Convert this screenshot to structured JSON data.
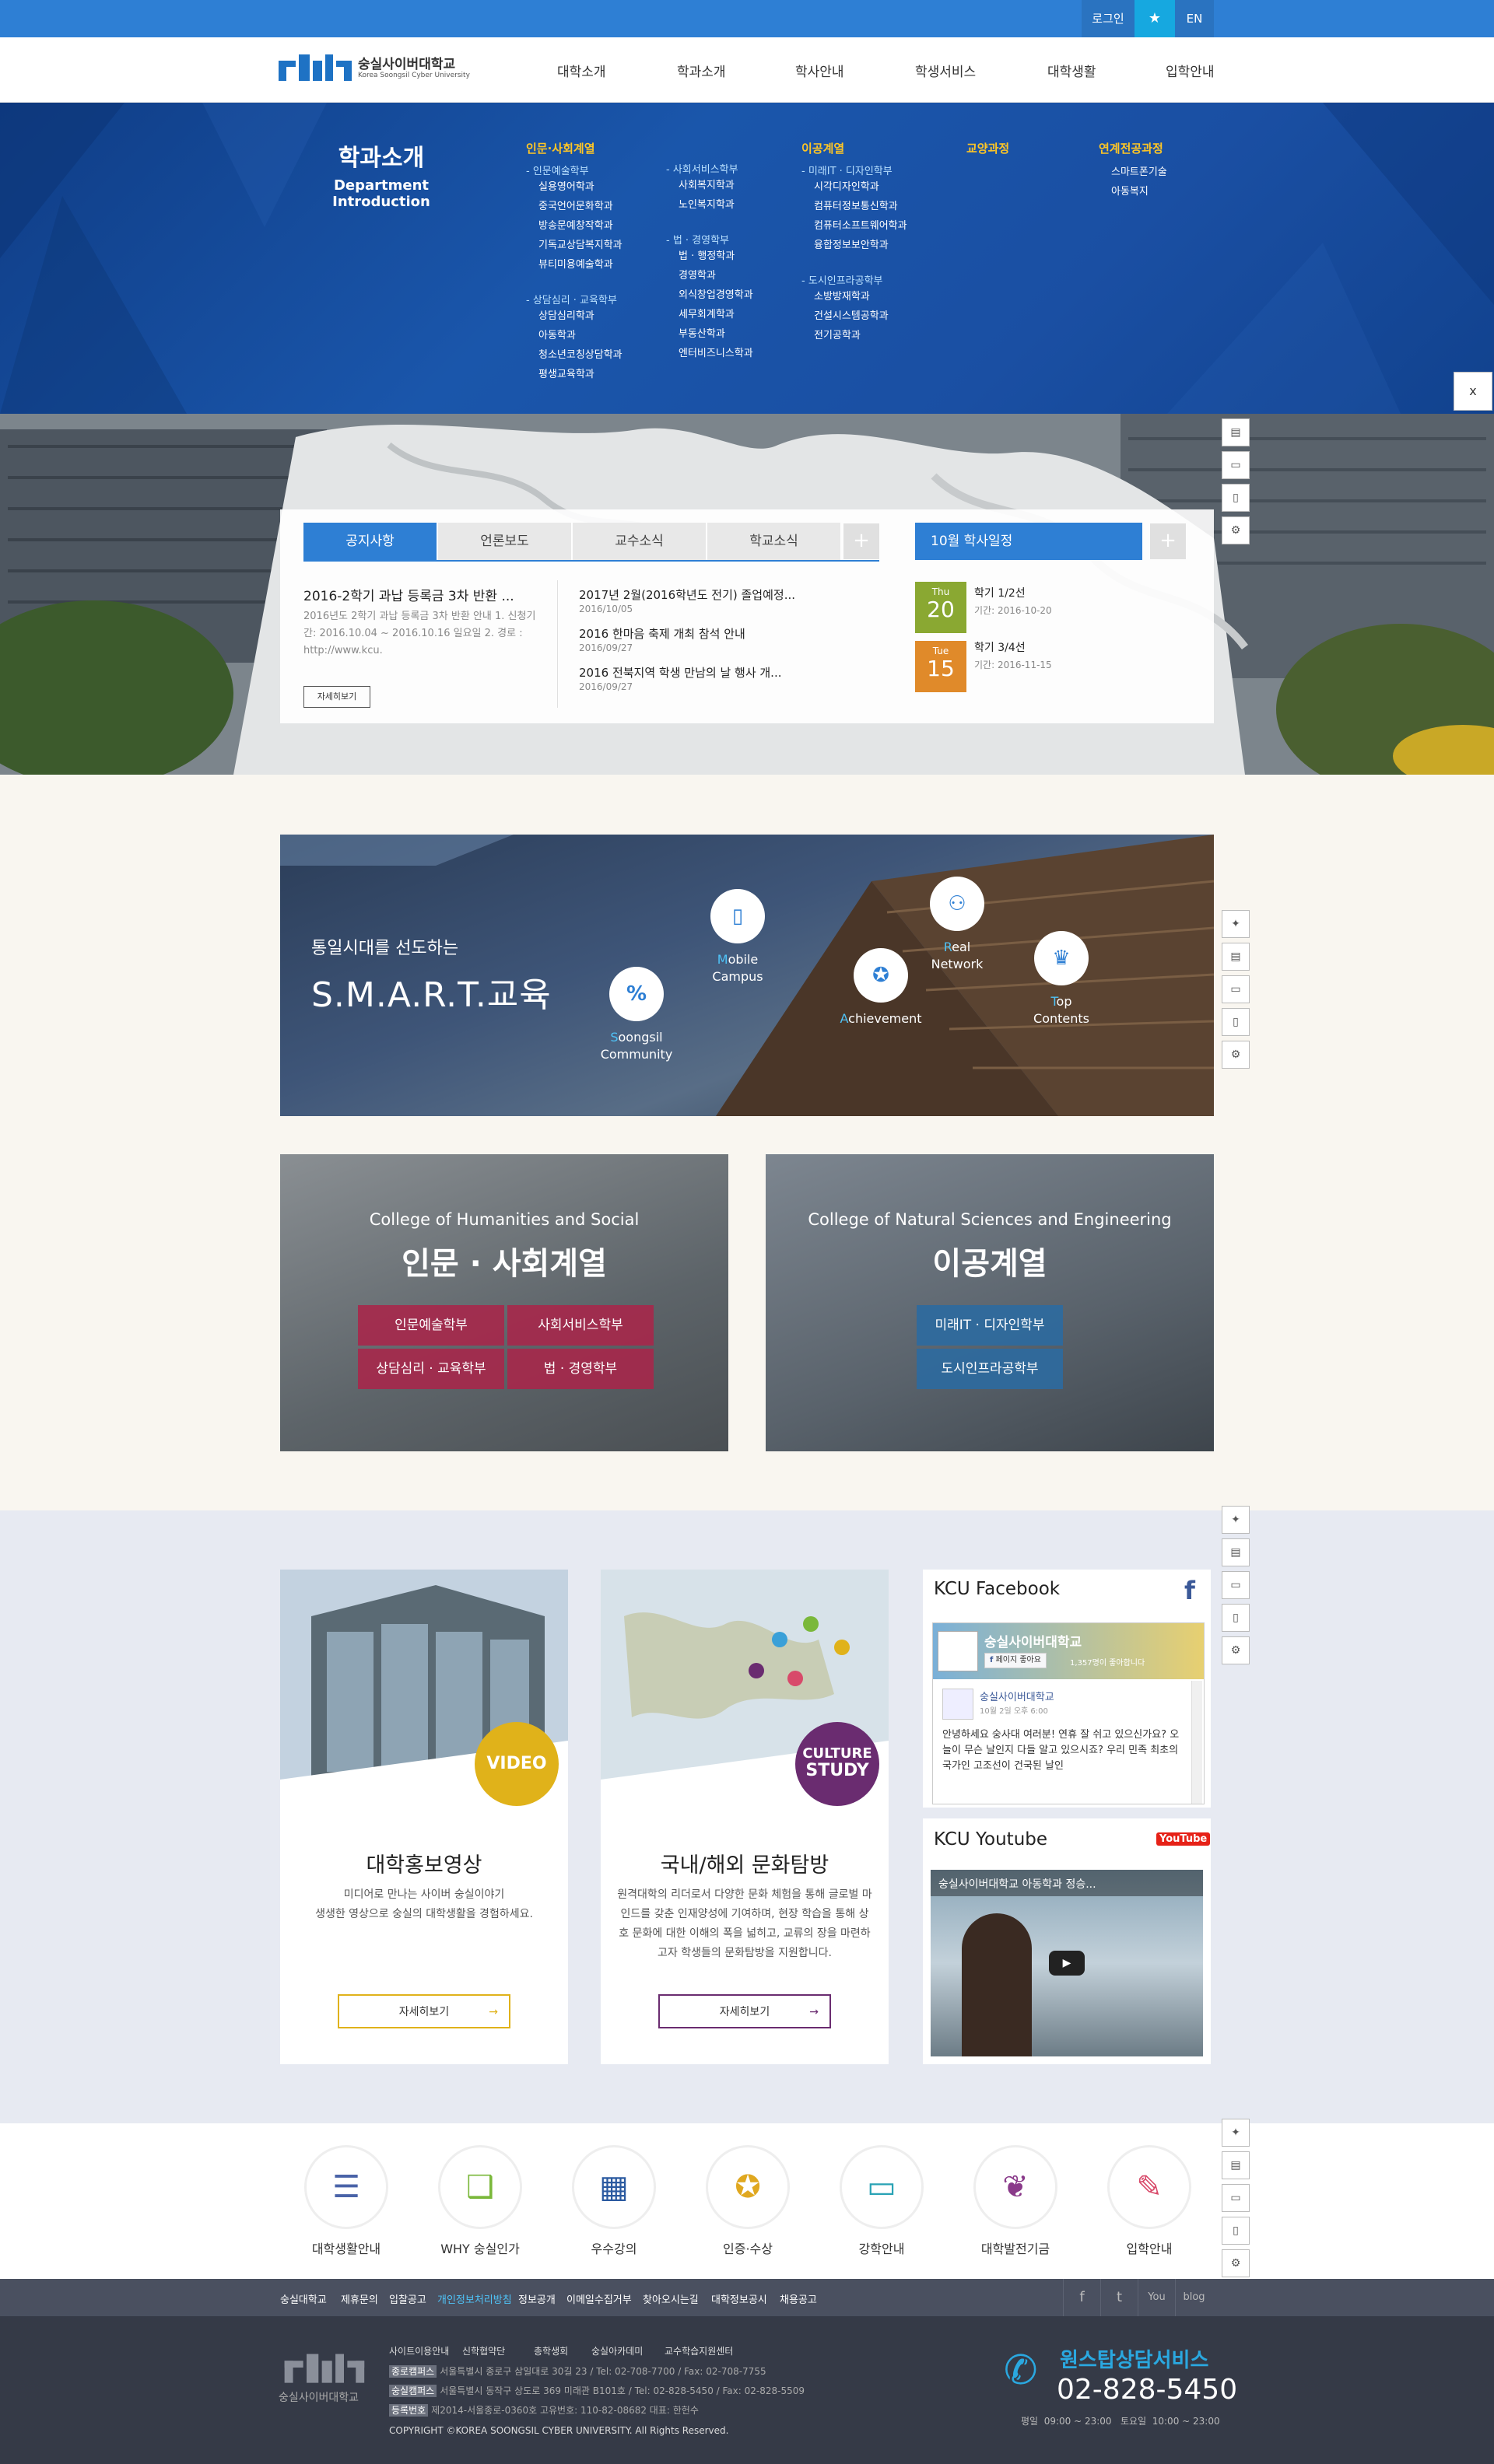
{
  "util": {
    "login": "로그인",
    "lang": "EN"
  },
  "logo": {
    "name": "숭실사이버대학교",
    "sub": "Korea Soongsil Cyber University",
    "mark": "kcu"
  },
  "gnb": [
    "대학소개",
    "학과소개",
    "학사안내",
    "학생서비스",
    "대학생활",
    "입학안내"
  ],
  "mega": {
    "title": "학과소개",
    "title_en": "Department Introduction",
    "columns": [
      {
        "head": "인문·사회계열",
        "groups": [
          {
            "name": "- 인문예술학부",
            "items": [
              "실용영어학과",
              "중국언어문화학과",
              "방송문예창작학과",
              "기독교상담복지학과",
              "뷰티미용예술학과"
            ]
          },
          {
            "name": "- 상담심리 · 교육학부",
            "items": [
              "상담심리학과",
              "아동학과",
              "청소년코칭상담학과",
              "평생교육학과"
            ]
          }
        ]
      },
      {
        "head": "",
        "groups": [
          {
            "name": "- 사회서비스학부",
            "items": [
              "사회복지학과",
              "노인복지학과"
            ]
          },
          {
            "name": "- 법 · 경영학부",
            "items": [
              "법 · 행정학과",
              "경영학과",
              "외식창업경영학과",
              "세무회계학과",
              "부동산학과",
              "엔터비즈니스학과"
            ]
          }
        ]
      },
      {
        "head": "이공계열",
        "groups": [
          {
            "name": "- 미래IT · 디자인학부",
            "items": [
              "시각디자인학과",
              "컴퓨터정보통신학과",
              "컴퓨터소프트웨어학과",
              "융합정보보안학과"
            ]
          },
          {
            "name": "- 도시인프라공학부",
            "items": [
              "소방방재학과",
              "건설시스템공학과",
              "전기공학과"
            ]
          }
        ]
      },
      {
        "head": "교양과정",
        "groups": []
      },
      {
        "head": "연계전공과정",
        "groups": [
          {
            "name": "",
            "items": [
              "스마트폰기술",
              "아동복지"
            ]
          }
        ]
      }
    ],
    "close": "x"
  },
  "notice": {
    "tabs": [
      "공지사항",
      "언론보도",
      "교수소식",
      "학교소식"
    ],
    "plus": "+",
    "featured": {
      "title": "2016-2학기 과납 등록금 3차 반환 ...",
      "body": "2016년도 2학기 과납 등록금 3차 반환 안내 1. 신청기간: 2016.10.04 ~ 2016.10.16 일요일 2. 경로 : http://www.kcu.",
      "more": "자세히보기"
    },
    "items": [
      {
        "title": "2017년 2월(2016학년도 전기) 졸업예정...",
        "date": "2016/10/05"
      },
      {
        "title": "2016 한마음 축제 개최 참석 안내",
        "date": "2016/09/27"
      },
      {
        "title": "2016 전북지역 학생 만남의 날 행사 개...",
        "date": "2016/09/27"
      }
    ]
  },
  "schedule": {
    "title": "10월 학사일정",
    "plus": "+",
    "events": [
      {
        "dow": "Thu",
        "day": "20",
        "title": "학기 1/2선",
        "period": "기간: 2016-10-20",
        "color": "#8aa832"
      },
      {
        "dow": "Tue",
        "day": "15",
        "title": "학기 3/4선",
        "period": "기간: 2016-11-15",
        "color": "#e08a2a"
      }
    ]
  },
  "smart": {
    "sub": "통일시대를 선도하는",
    "title": "S.M.A.R.T.교육",
    "items": [
      {
        "first": "S",
        "rest": "oongsil",
        "line2": "Community"
      },
      {
        "first": "M",
        "rest": "obile",
        "line2": "Campus"
      },
      {
        "first": "A",
        "rest": "chievement",
        "line2": ""
      },
      {
        "first": "R",
        "rest": "eal",
        "line2": "Network"
      },
      {
        "first": "T",
        "rest": "op",
        "line2": "Contents"
      }
    ],
    "accent": "#4fc3f7"
  },
  "colleges": [
    {
      "sub": "College of Humanities and Social",
      "title": "인문 · 사회계열",
      "buttons": [
        "인문예술학부",
        "사회서비스학부",
        "상담심리 · 교육학부",
        "법 · 경영학부"
      ],
      "color": "#a8264a"
    },
    {
      "sub": "College of Natural Sciences and Engineering",
      "title": "이공계열",
      "buttons": [
        "미래IT · 디자인학부",
        "도시인프라공학부"
      ],
      "color": "#2c6aa0"
    }
  ],
  "cards": [
    {
      "badge": "VIDEO",
      "title": "대학홍보영상",
      "desc": "미디어로 만나는 사이버 숭실이야기\n생생한 영상으로 숭실의 대학생활을 경험하세요.",
      "more": "자세히보기",
      "color": "#e0b21a"
    },
    {
      "badge": "CULTURE STUDY",
      "badge1": "CULTURE",
      "badge2": "STUDY",
      "title": "국내/해외 문화탐방",
      "desc": "원격대학의 리더로서 다양한 문화 체험을 통해 글로벌 마인드를 갖춘 인재양성에 기여하며, 현장 학습을 통해 상호 문화에 대한 이해의 폭을 넓히고, 교류의 장을 마련하고자 학생들의 문화탐방을 지원합니다.",
      "more": "자세히보기",
      "color": "#6a2c70"
    }
  ],
  "facebook": {
    "title": "KCU Facebook",
    "page": "숭실사이버대학교",
    "like": "페이지 좋아요",
    "likes": "1,357명이 좋아합니다",
    "post_name": "숭실사이버대학교",
    "post_date": "10월 2일 오후 6:00",
    "post_text": "안녕하세요 숭사대 여러분! 연휴 잘 쉬고 있으신가요? 오늘이 무슨 날인지 다들 알고 있으시죠? 우리 민족 최초의 국가인 고조선이 건국된 날인"
  },
  "youtube": {
    "title": "KCU Youtube",
    "logo": "YouTube",
    "video_title": "숭실사이버대학교 아동학과 정승..."
  },
  "quick": [
    {
      "label": "대학생활안내",
      "icon": "book-stack-icon",
      "color": "#4a63a8"
    },
    {
      "label": "WHY 숭실인가",
      "icon": "why-book-icon",
      "color": "#7ab83a"
    },
    {
      "label": "우수강의",
      "icon": "presentation-board-icon",
      "color": "#2b5aa0"
    },
    {
      "label": "인증·수상",
      "icon": "medal-icon",
      "color": "#e0a820"
    },
    {
      "label": "강학안내",
      "icon": "monitor-icon",
      "color": "#2aa3b5"
    },
    {
      "label": "대학발전기금",
      "icon": "piggy-bank-icon",
      "color": "#8a3a8a"
    },
    {
      "label": "입학안내",
      "icon": "application-form-icon",
      "color": "#d84a6a"
    }
  ],
  "footLinks": [
    "숭실대학교",
    "제휴문의",
    "입찰공고",
    "개인정보처리방침",
    "정보공개",
    "이메일수집거부",
    "찾아오시는길",
    "대학정보공시",
    "채용공고"
  ],
  "footLinkHighlight": "#4fc3f7",
  "social": [
    "f",
    "t",
    "You",
    "blog"
  ],
  "footer": {
    "logo_name": "숭실사이버대학교",
    "links": [
      "사이트이용안내",
      "신학협약단",
      "총학생회",
      "숭실아카데미",
      "교수학습지원센터"
    ],
    "addr": [
      {
        "tag": "종로캠퍼스",
        "text": "서울특별시 종로구 삼일대로 30길 23 / Tel: 02-708-7700 / Fax: 02-708-7755"
      },
      {
        "tag": "숭실캠퍼스",
        "text": "서울특별시 동작구 상도로 369 미래관 B101호 / Tel: 02-828-5450 / Fax: 02-828-5509"
      },
      {
        "tag": "등록번호",
        "text": "제2014-서울종로-0360호 고유번호: 110-82-08682 대표: 한헌수"
      }
    ],
    "copyright": "COPYRIGHT ©KOREA SOONGSIL CYBER UNIVERSITY. All Rights Reserved.",
    "svc_title": "원스탑상담서비스",
    "phone": "02-828-5450",
    "hours": "평일  09:00 ~ 23:00   토요일  10:00 ~ 23:00"
  }
}
